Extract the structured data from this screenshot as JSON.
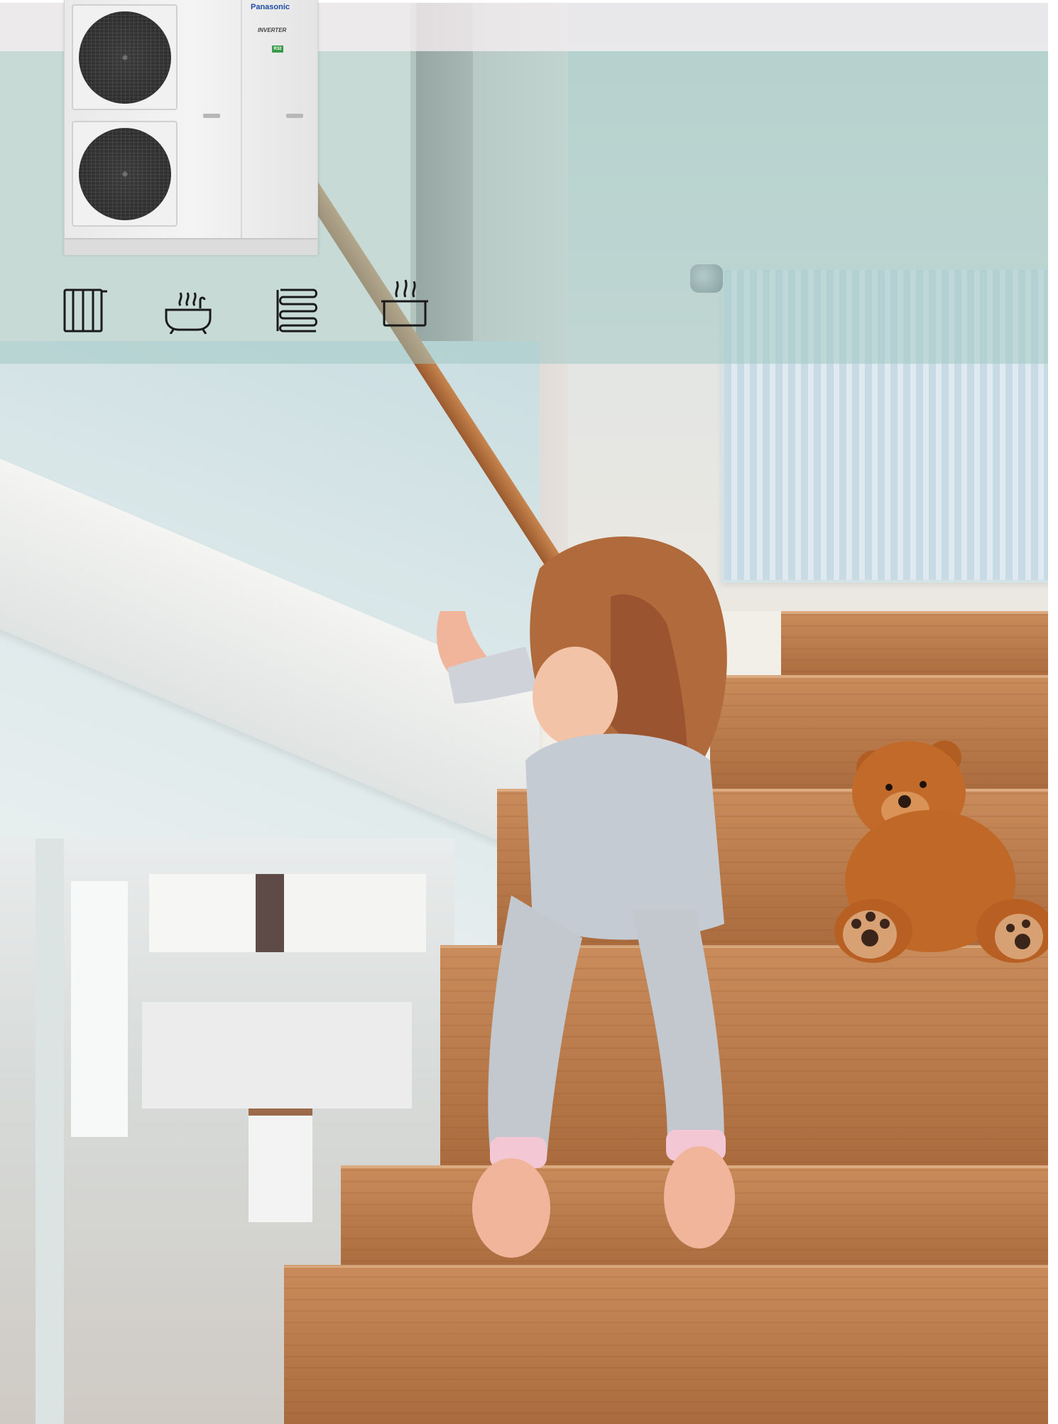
{
  "product": {
    "brand": "Panasonic",
    "series_badge": "INVERTER",
    "refrigerant_badge": "R32"
  },
  "icons": [
    {
      "name": "radiator-icon"
    },
    {
      "name": "bathtub-icon"
    },
    {
      "name": "underfloor-heating-icon"
    },
    {
      "name": "hot-water-tank-icon"
    }
  ],
  "colors": {
    "band_teal": "#a0c8c4",
    "brand_blue": "#1d4ea1",
    "wood": "#b97a48",
    "icon_stroke": "#1a1a1a"
  }
}
